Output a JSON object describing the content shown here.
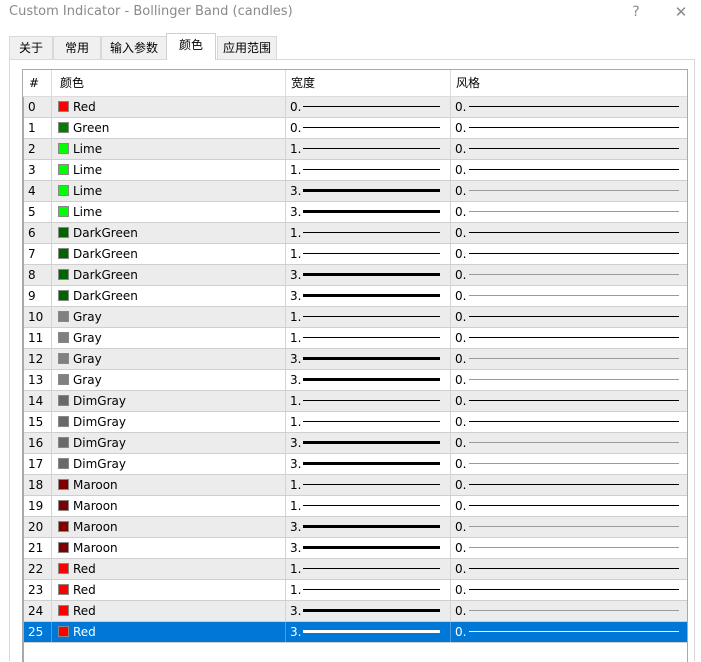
{
  "window": {
    "title": "Custom Indicator - Bollinger Band (candles)",
    "help_glyph": "?",
    "close_glyph": "✕"
  },
  "tabs": [
    {
      "label": "关于",
      "active": false
    },
    {
      "label": "常用",
      "active": false
    },
    {
      "label": "输入参数",
      "active": false
    },
    {
      "label": "颜色",
      "active": true
    },
    {
      "label": "应用范围",
      "active": false
    }
  ],
  "grid": {
    "columns": {
      "num": "#",
      "color": "颜色",
      "width": "宽度",
      "style": "风格"
    },
    "rows": [
      {
        "num": "0",
        "name": "Red",
        "hex": "#ff0000",
        "width": "0.",
        "width_level": 1,
        "style": "0.",
        "selected": false
      },
      {
        "num": "1",
        "name": "Green",
        "hex": "#008000",
        "width": "0.",
        "width_level": 1,
        "style": "0.",
        "selected": false
      },
      {
        "num": "2",
        "name": "Lime",
        "hex": "#00ff00",
        "width": "1.",
        "width_level": 1,
        "style": "0.",
        "selected": false
      },
      {
        "num": "3",
        "name": "Lime",
        "hex": "#00ff00",
        "width": "1.",
        "width_level": 1,
        "style": "0.",
        "selected": false
      },
      {
        "num": "4",
        "name": "Lime",
        "hex": "#00ff00",
        "width": "3.",
        "width_level": 3,
        "style": "0.",
        "selected": false
      },
      {
        "num": "5",
        "name": "Lime",
        "hex": "#00ff00",
        "width": "3.",
        "width_level": 3,
        "style": "0.",
        "selected": false
      },
      {
        "num": "6",
        "name": "DarkGreen",
        "hex": "#006400",
        "width": "1.",
        "width_level": 1,
        "style": "0.",
        "selected": false
      },
      {
        "num": "7",
        "name": "DarkGreen",
        "hex": "#006400",
        "width": "1.",
        "width_level": 1,
        "style": "0.",
        "selected": false
      },
      {
        "num": "8",
        "name": "DarkGreen",
        "hex": "#006400",
        "width": "3.",
        "width_level": 3,
        "style": "0.",
        "selected": false
      },
      {
        "num": "9",
        "name": "DarkGreen",
        "hex": "#006400",
        "width": "3.",
        "width_level": 3,
        "style": "0.",
        "selected": false
      },
      {
        "num": "10",
        "name": "Gray",
        "hex": "#808080",
        "width": "1.",
        "width_level": 1,
        "style": "0.",
        "selected": false
      },
      {
        "num": "11",
        "name": "Gray",
        "hex": "#808080",
        "width": "1.",
        "width_level": 1,
        "style": "0.",
        "selected": false
      },
      {
        "num": "12",
        "name": "Gray",
        "hex": "#808080",
        "width": "3.",
        "width_level": 3,
        "style": "0.",
        "selected": false
      },
      {
        "num": "13",
        "name": "Gray",
        "hex": "#808080",
        "width": "3.",
        "width_level": 3,
        "style": "0.",
        "selected": false
      },
      {
        "num": "14",
        "name": "DimGray",
        "hex": "#696969",
        "width": "1.",
        "width_level": 1,
        "style": "0.",
        "selected": false
      },
      {
        "num": "15",
        "name": "DimGray",
        "hex": "#696969",
        "width": "1.",
        "width_level": 1,
        "style": "0.",
        "selected": false
      },
      {
        "num": "16",
        "name": "DimGray",
        "hex": "#696969",
        "width": "3.",
        "width_level": 3,
        "style": "0.",
        "selected": false
      },
      {
        "num": "17",
        "name": "DimGray",
        "hex": "#696969",
        "width": "3.",
        "width_level": 3,
        "style": "0.",
        "selected": false
      },
      {
        "num": "18",
        "name": "Maroon",
        "hex": "#800000",
        "width": "1.",
        "width_level": 1,
        "style": "0.",
        "selected": false
      },
      {
        "num": "19",
        "name": "Maroon",
        "hex": "#800000",
        "width": "1.",
        "width_level": 1,
        "style": "0.",
        "selected": false
      },
      {
        "num": "20",
        "name": "Maroon",
        "hex": "#800000",
        "width": "3.",
        "width_level": 3,
        "style": "0.",
        "selected": false
      },
      {
        "num": "21",
        "name": "Maroon",
        "hex": "#800000",
        "width": "3.",
        "width_level": 3,
        "style": "0.",
        "selected": false
      },
      {
        "num": "22",
        "name": "Red",
        "hex": "#ff0000",
        "width": "1.",
        "width_level": 1,
        "style": "0.",
        "selected": false
      },
      {
        "num": "23",
        "name": "Red",
        "hex": "#ff0000",
        "width": "1.",
        "width_level": 1,
        "style": "0.",
        "selected": false
      },
      {
        "num": "24",
        "name": "Red",
        "hex": "#ff0000",
        "width": "3.",
        "width_level": 3,
        "style": "0.",
        "selected": false
      },
      {
        "num": "25",
        "name": "Red",
        "hex": "#ff0000",
        "width": "3.",
        "width_level": 3,
        "style": "0.",
        "selected": true
      }
    ]
  }
}
